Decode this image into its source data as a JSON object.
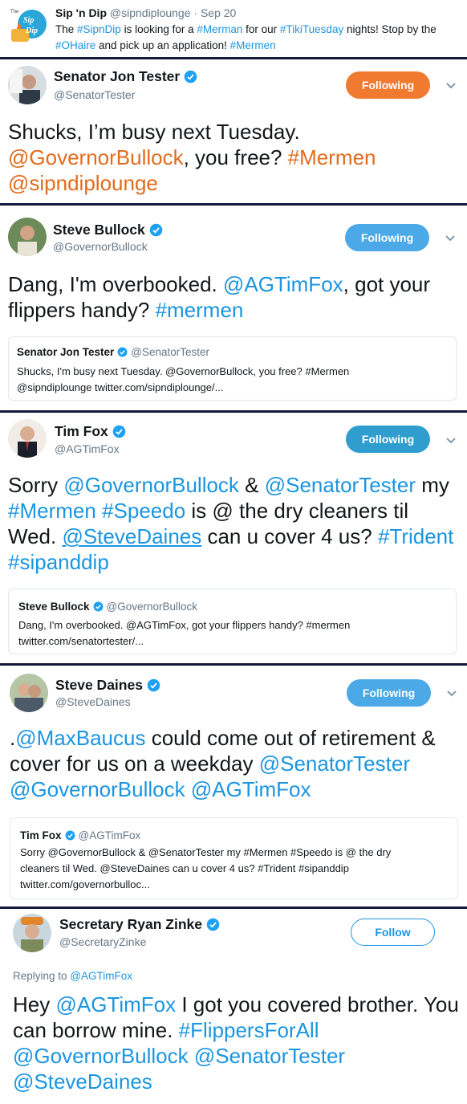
{
  "top_tweet": {
    "logo": {
      "label_small": "The",
      "label_big": "Sip'n Dip",
      "icon": "sipndip-logo"
    },
    "name": "Sip 'n Dip",
    "handle": "@sipndiplounge",
    "sep": " · ",
    "date": "Sep 20",
    "text_parts": [
      {
        "t": "The ",
        "link": false
      },
      {
        "t": "#SipnDip",
        "link": true
      },
      {
        "t": " is looking for a ",
        "link": false
      },
      {
        "t": "#Merman",
        "link": true
      },
      {
        "t": " for our ",
        "link": false
      },
      {
        "t": "#TikiTuesday",
        "link": true
      },
      {
        "t": " nights! Stop by the ",
        "link": false
      },
      {
        "t": "#OHaire",
        "link": true
      },
      {
        "t": " and pick up an application! ",
        "link": false
      },
      {
        "t": "#Mermen",
        "link": true
      }
    ]
  },
  "tweets": [
    {
      "name": "Senator Jon Tester",
      "handle": "@SenatorTester",
      "button": "Following",
      "button_color": "#f07a2f",
      "link_color": "#e36b1c",
      "text_parts": [
        {
          "t": "Shucks, I’m busy next Tuesday. ",
          "link": false
        },
        {
          "t": "@GovernorBullock",
          "link": true
        },
        {
          "t": ", you free? ",
          "link": false
        },
        {
          "t": "#Mermen",
          "link": true
        },
        {
          "t": " ",
          "link": false
        },
        {
          "t": "@sipndiplounge",
          "link": true
        }
      ]
    },
    {
      "name": "Steve Bullock",
      "handle": "@GovernorBullock",
      "button": "Following",
      "button_color": "#4aa9e6",
      "link_color": "#1b95e0",
      "text_parts": [
        {
          "t": "Dang, I'm overbooked. ",
          "link": false
        },
        {
          "t": "@AGTimFox",
          "link": true
        },
        {
          "t": ", got your flippers handy? ",
          "link": false
        },
        {
          "t": "#mermen",
          "link": true
        }
      ],
      "quote": {
        "name": "Senator Jon Tester",
        "handle": "@SenatorTester",
        "line1": "Shucks, I'm busy next Tuesday. @GovernorBullock, you free? #Mermen",
        "line2": "@sipndiplounge twitter.com/sipndiplounge/..."
      }
    },
    {
      "name": "Tim Fox",
      "handle": "@AGTimFox",
      "button": "Following",
      "button_color": "#2f9ecf",
      "link_color": "#1b95e0",
      "text_parts": [
        {
          "t": "Sorry ",
          "link": false
        },
        {
          "t": "@GovernorBullock",
          "link": true
        },
        {
          "t": " & ",
          "link": false
        },
        {
          "t": "@SenatorTester",
          "link": true
        },
        {
          "t": " my ",
          "link": false
        },
        {
          "t": "#Mermen",
          "link": true
        },
        {
          "t": " ",
          "link": false
        },
        {
          "t": "#Speedo",
          "link": true
        },
        {
          "t": " is @ the dry cleaners til Wed. ",
          "link": false
        },
        {
          "t": "@SteveDaines",
          "link": true,
          "underline": true
        },
        {
          "t": " can u cover 4 us? ",
          "link": false
        },
        {
          "t": "#Trident",
          "link": true
        },
        {
          "t": " ",
          "link": false
        },
        {
          "t": "#sipanddip",
          "link": true
        }
      ],
      "quote": {
        "name": "Steve Bullock",
        "handle": "@GovernorBullock",
        "line1": "Dang, I'm overbooked. @AGTimFox, got your flippers handy? #mermen",
        "line2": "twitter.com/senatortester/..."
      }
    },
    {
      "name": "Steve Daines",
      "handle": "@SteveDaines",
      "button": "Following",
      "button_color": "#4aa9e6",
      "link_color": "#1b95e0",
      "text_parts": [
        {
          "t": ".",
          "link": false
        },
        {
          "t": "@MaxBaucus",
          "link": true
        },
        {
          "t": " could come out of retirement & cover for us on a weekday ",
          "link": false
        },
        {
          "t": "@SenatorTester",
          "link": true
        },
        {
          "t": " ",
          "link": false
        },
        {
          "t": "@GovernorBullock",
          "link": true
        },
        {
          "t": " ",
          "link": false
        },
        {
          "t": "@AGTimFox",
          "link": true
        }
      ],
      "quote": {
        "name": "Tim Fox",
        "handle": "@AGTimFox",
        "line1": "Sorry @GovernorBullock & @SenatorTester my #Mermen #Speedo is @ the dry",
        "line2": "cleaners til Wed. @SteveDaines can u cover 4 us? #Trident #sipanddip",
        "line3": "twitter.com/governorbulloc..."
      }
    },
    {
      "name": "Secretary Ryan Zinke",
      "handle": "@SecretaryZinke",
      "button": "Follow",
      "button_color": "#ffffff",
      "link_color": "#1b95e0",
      "reply_prefix": "Replying to ",
      "reply_handle": "@AGTimFox",
      "text_parts": [
        {
          "t": "Hey ",
          "link": false
        },
        {
          "t": "@AGTimFox",
          "link": true
        },
        {
          "t": " I got you covered brother. You can borrow mine. ",
          "link": false
        },
        {
          "t": "#FlippersForAll",
          "link": true
        },
        {
          "t": " ",
          "link": false
        },
        {
          "t": "@GovernorBullock",
          "link": true
        },
        {
          "t": " ",
          "link": false
        },
        {
          "t": "@SenatorTester",
          "link": true
        },
        {
          "t": " ",
          "link": false
        },
        {
          "t": "@SteveDaines",
          "link": true
        }
      ]
    }
  ],
  "icons": {
    "verified": "verified-badge-icon",
    "more": "chevron-down-icon"
  }
}
